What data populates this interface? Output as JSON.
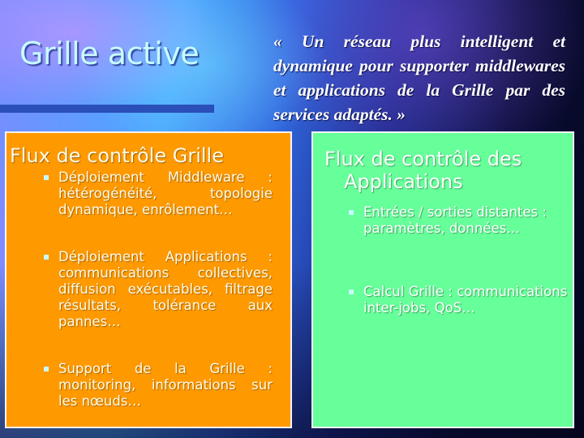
{
  "slide": {
    "title": "Grille active",
    "quote": "« Un réseau plus intelligent et dynamique pour supporter middlewares et applications de la Grille par des services adaptés. »"
  },
  "left_box": {
    "title": "Flux de contrôle Grille",
    "bullets": [
      "Déploiement Middleware : hétérogénéité, topologie dynamique, enrôlement…",
      "Déploiement Applications : communications collectives, diffusion exécutables, filtrage résultats, tolérance aux pannes…",
      "Support de la Grille : monitoring, informations sur les nœuds…"
    ]
  },
  "right_box": {
    "title_line1": "Flux de contrôle des",
    "title_line2": "Applications",
    "bullets": [
      "Entrées / sorties distantes : paramètres, données…",
      "Calcul Grille : communications inter-jobs, QoS…"
    ]
  },
  "colors": {
    "left_box_bg": "#ff9900",
    "right_box_bg": "#66ff99",
    "title_color": "#c8fbff",
    "title_bar": "#2a4fb8",
    "bullet_mark": "#c8fbff"
  }
}
